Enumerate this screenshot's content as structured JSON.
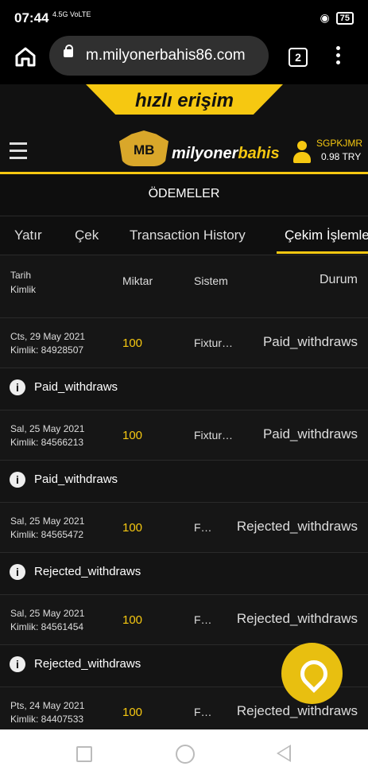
{
  "statusbar": {
    "time": "07:44",
    "network": "4.5G VoLTE",
    "battery": "75"
  },
  "browser": {
    "url": "m.milyonerbahis86.com",
    "tab_count": "2"
  },
  "site": {
    "quick_access": "hızlı erişim",
    "logo_mark": "MB",
    "logo_name_1": "milyoner",
    "logo_name_2": "bahis",
    "user": {
      "name": "SGPKJMR",
      "balance": "0.98 TRY"
    },
    "brand_color": "#f6c811"
  },
  "page": {
    "title": "ÖDEMELER",
    "tabs": [
      "Yatır",
      "Çek",
      "Transaction History",
      "Çekim İşlemle"
    ],
    "active_tab": "Çekim İşlemle"
  },
  "table": {
    "headers": {
      "date": "Tarih",
      "id": "Kimlik",
      "amount": "Miktar",
      "system": "Sistem",
      "status": "Durum"
    },
    "rows": [
      {
        "date": "Cts, 29 May 2021",
        "id": "Kimlik: 84928507",
        "amount": "100",
        "system": "Fixtur…",
        "status": "Paid_withdraws",
        "detail": "Paid_withdraws"
      },
      {
        "date": "Sal, 25 May 2021",
        "id": "Kimlik: 84566213",
        "amount": "100",
        "system": "Fixtur…",
        "status": "Paid_withdraws",
        "detail": "Paid_withdraws"
      },
      {
        "date": "Sal, 25 May 2021",
        "id": "Kimlik: 84565472",
        "amount": "100",
        "system": "F…",
        "status": "Rejected_withdraws",
        "detail": "Rejected_withdraws"
      },
      {
        "date": "Sal, 25 May 2021",
        "id": "Kimlik: 84561454",
        "amount": "100",
        "system": "F…",
        "status": "Rejected_withdraws",
        "detail": "Rejected_withdraws"
      },
      {
        "date": "Pts, 24 May 2021",
        "id": "Kimlik: 84407533",
        "amount": "100",
        "system": "F…",
        "status": "Rejected_withdraws",
        "detail": ""
      }
    ]
  }
}
